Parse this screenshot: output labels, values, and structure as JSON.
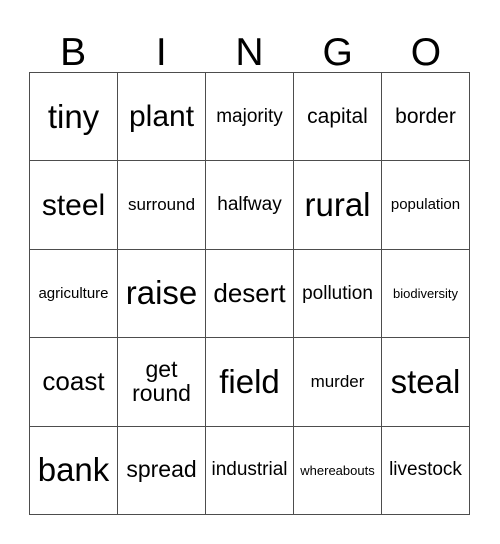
{
  "card": {
    "title": "BINGO",
    "header_letters": [
      "B",
      "I",
      "N",
      "G",
      "O"
    ],
    "columns": 5,
    "rows": 5,
    "grid_border_color": "#4d4d4d",
    "text_color": "#000000",
    "background_color": "#ffffff",
    "cells": [
      [
        {
          "text": "tiny",
          "size": "fs-xxl"
        },
        {
          "text": "plant",
          "size": "fs-xl"
        },
        {
          "text": "majority",
          "size": "fs-xs"
        },
        {
          "text": "capital",
          "size": "fs-s"
        },
        {
          "text": "border",
          "size": "fs-s"
        }
      ],
      [
        {
          "text": "steel",
          "size": "fs-xl"
        },
        {
          "text": "surround",
          "size": "fs-xxs"
        },
        {
          "text": "halfway",
          "size": "fs-xs"
        },
        {
          "text": "rural",
          "size": "fs-xxl"
        },
        {
          "text": "population",
          "size": "fs-3xs"
        }
      ],
      [
        {
          "text": "agriculture",
          "size": "fs-3xs"
        },
        {
          "text": "raise",
          "size": "fs-xxl"
        },
        {
          "text": "desert",
          "size": "fs-l"
        },
        {
          "text": "pollution",
          "size": "fs-xs"
        },
        {
          "text": "biodiversity",
          "size": "fs-4xs"
        }
      ],
      [
        {
          "text": "coast",
          "size": "fs-l"
        },
        {
          "text": "get round",
          "size": "fs-m"
        },
        {
          "text": "field",
          "size": "fs-xxl"
        },
        {
          "text": "murder",
          "size": "fs-xxs"
        },
        {
          "text": "steal",
          "size": "fs-xxl"
        }
      ],
      [
        {
          "text": "bank",
          "size": "fs-xxl"
        },
        {
          "text": "spread",
          "size": "fs-m"
        },
        {
          "text": "industrial",
          "size": "fs-xs"
        },
        {
          "text": "whereabouts",
          "size": "fs-4xs"
        },
        {
          "text": "livestock",
          "size": "fs-xs"
        }
      ]
    ]
  }
}
